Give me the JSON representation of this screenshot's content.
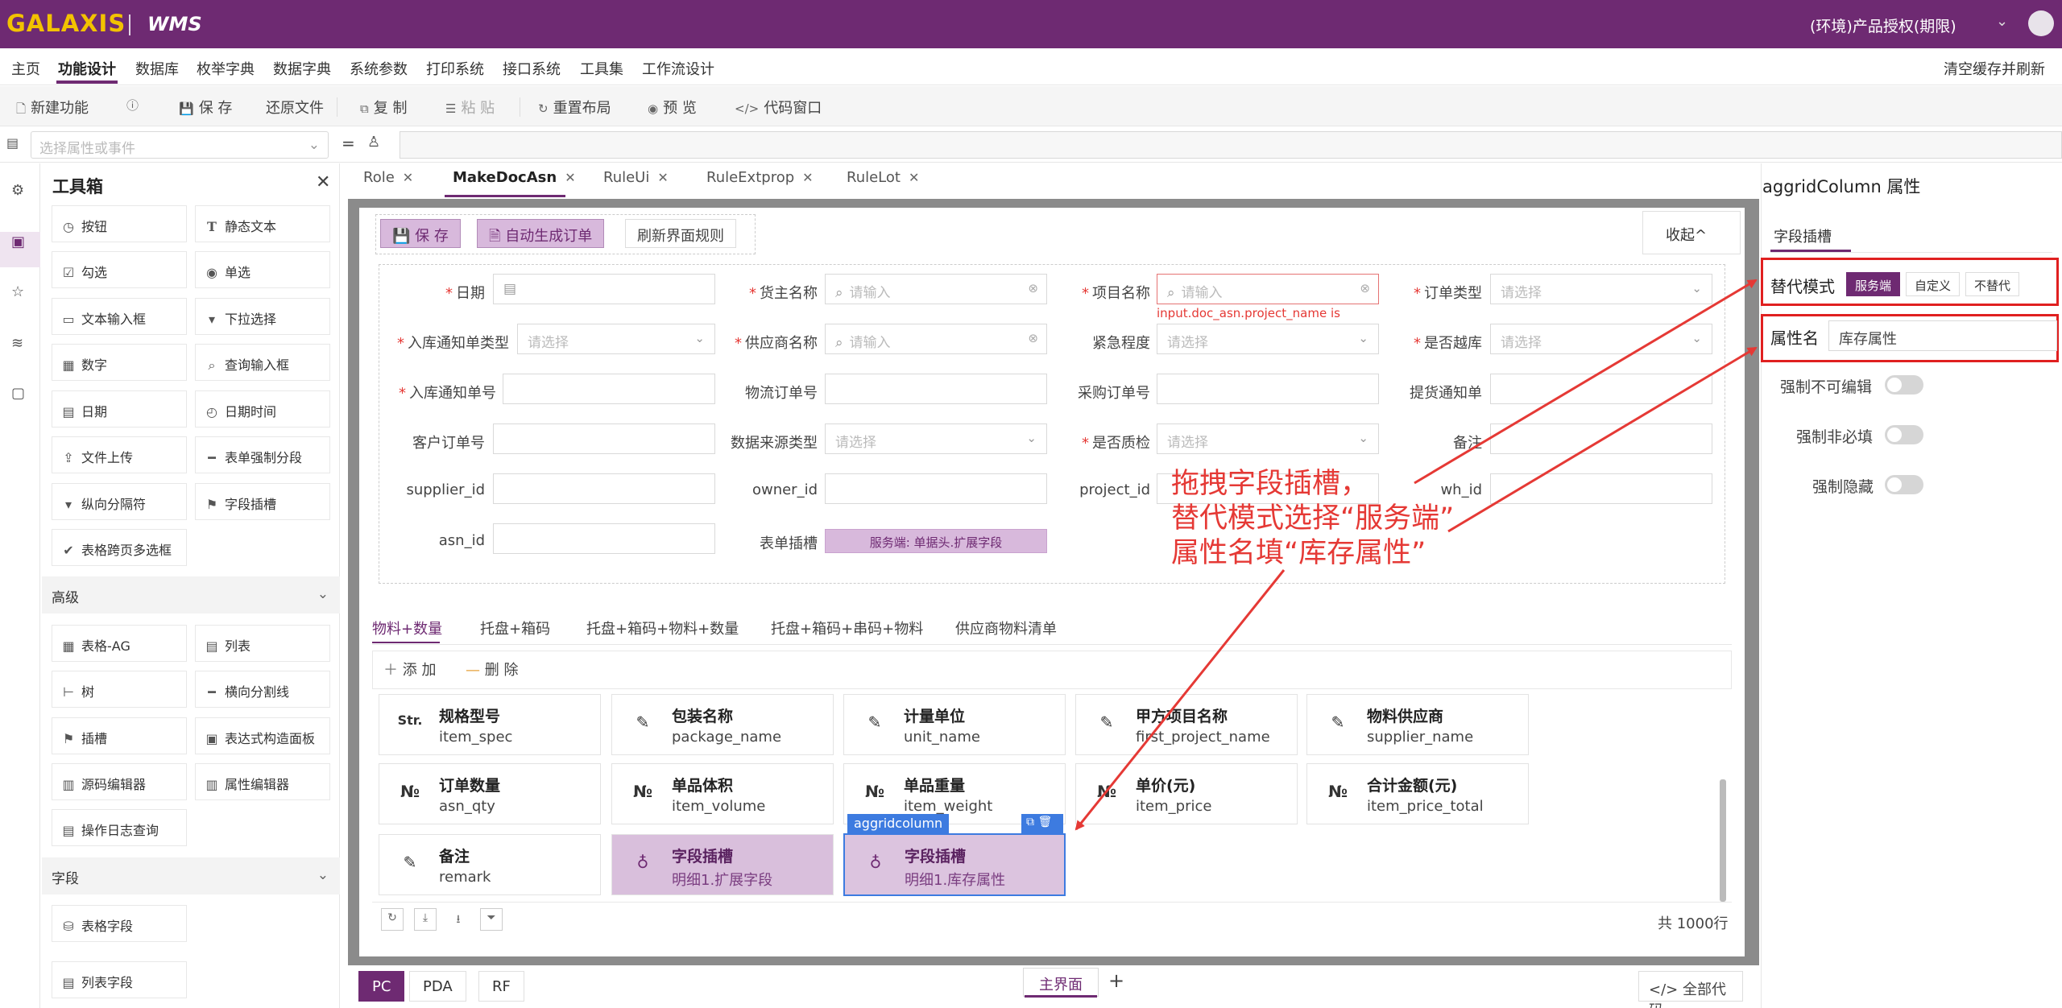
{
  "app": {
    "logo": "GALAXIS",
    "product": "WMS",
    "license": "(环境)产品授权(期限)"
  },
  "menu": {
    "items": [
      "主页",
      "功能设计",
      "数据库",
      "枚举字典",
      "数据字典",
      "系统参数",
      "打印系统",
      "接口系统",
      "工具集",
      "工作流设计"
    ],
    "clear_cache": "清空缓存并刷新"
  },
  "toolbar": {
    "new": "新建功能",
    "save": "保 存",
    "restore": "还原文件",
    "copy": "复 制",
    "paste": "粘 贴",
    "relayout": "重置布局",
    "preview": "预 览",
    "code": "代码窗口"
  },
  "select_prop": {
    "placeholder": "选择属性或事件"
  },
  "toolbox": {
    "title": "工具箱",
    "basic": [
      "按钮",
      "静态文本",
      "勾选",
      "单选",
      "文本输入框",
      "下拉选择",
      "数字",
      "查询输入框",
      "日期",
      "日期时间",
      "文件上传",
      "表单强制分段",
      "纵向分隔符",
      "字段插槽",
      "表格跨页多选框"
    ],
    "advanced_title": "高级",
    "advanced": [
      "表格-AG",
      "列表",
      "树",
      "横向分割线",
      "插槽",
      "表达式构造面板",
      "源码编辑器",
      "属性编辑器",
      "操作日志查询"
    ],
    "field_title": "字段",
    "fields": [
      "表格字段",
      "列表字段"
    ]
  },
  "doc_tabs": [
    "Role",
    "MakeDocAsn",
    "RuleUi",
    "RuleExtprop",
    "RuleLot"
  ],
  "form": {
    "buttons": {
      "save": "保 存",
      "auto_order": "自动生成订单",
      "refresh": "刷新界面规则",
      "collapse": "收起^"
    },
    "labels": {
      "date": "日期",
      "owner": "货主名称",
      "project": "项目名称",
      "order_type": "订单类型",
      "notice_type": "入库通知单类型",
      "supplier": "供应商名称",
      "urgency": "紧急程度",
      "overbook": "是否越库",
      "notice_no": "入库通知单号",
      "logistics": "物流订单号",
      "purchase": "采购订单号",
      "pickup": "提货通知单",
      "customer": "客户订单号",
      "source": "数据来源类型",
      "qc": "是否质检",
      "remark": "备注",
      "supplier_id": "supplier_id",
      "owner_id": "owner_id",
      "project_id": "project_id",
      "wh_id": "wh_id",
      "asn_id": "asn_id",
      "slot": "表单插槽"
    },
    "placeholder_input": "请输入",
    "placeholder_select": "请选择",
    "error": "input.doc_asn.project_name is",
    "slot_tag": "服务端: 单据头.扩展字段"
  },
  "inner_tabs": [
    "物料+数量",
    "托盘+箱码",
    "托盘+箱码+物料+数量",
    "托盘+箱码+串码+物料",
    "供应商物料清单"
  ],
  "grid": {
    "add": "添 加",
    "delete": "删 除",
    "total": "共 1000行",
    "cards": [
      {
        "icon": "Str.",
        "title": "规格型号",
        "sub": "item_spec"
      },
      {
        "icon": "✎",
        "title": "包装名称",
        "sub": "package_name"
      },
      {
        "icon": "✎",
        "title": "计量单位",
        "sub": "unit_name"
      },
      {
        "icon": "✎",
        "title": "甲方项目名称",
        "sub": "first_project_name"
      },
      {
        "icon": "✎",
        "title": "物料供应商",
        "sub": "supplier_name"
      },
      {
        "icon": "№",
        "title": "订单数量",
        "sub": "asn_qty"
      },
      {
        "icon": "№",
        "title": "单品体积",
        "sub": "item_volume"
      },
      {
        "icon": "№",
        "title": "单品重量",
        "sub": "item_weight"
      },
      {
        "icon": "№",
        "title": "单价(元)",
        "sub": "item_price"
      },
      {
        "icon": "№",
        "title": "合计金额(元)",
        "sub": "item_price_total"
      },
      {
        "icon": "✎",
        "title": "备注",
        "sub": "remark"
      },
      {
        "icon": "♁",
        "title": "字段插槽",
        "sub": "明细1.扩展字段"
      },
      {
        "icon": "♁",
        "title": "字段插槽",
        "sub": "明细1.库存属性"
      }
    ],
    "selected_label": "aggridcolumn"
  },
  "bottom": {
    "tabs": [
      "PC",
      "PDA",
      "RF"
    ],
    "main": "主界面",
    "all_code": "全部代码"
  },
  "props": {
    "title": "aggridColumn 属性",
    "tab": "字段插槽",
    "mode_label": "替代模式",
    "modes": [
      "服务端",
      "自定义",
      "不替代"
    ],
    "attr_label": "属性名",
    "attr_value": "库存属性",
    "switches": [
      "强制不可编辑",
      "强制非必填",
      "强制隐藏"
    ]
  },
  "annotation": [
    "拖拽字段插槽，",
    "替代模式选择“服务端”",
    "属性名填“库存属性”"
  ],
  "colors": {
    "brand": "#6e2a72",
    "accent": "#f2c200",
    "annotation": "#e53935"
  }
}
